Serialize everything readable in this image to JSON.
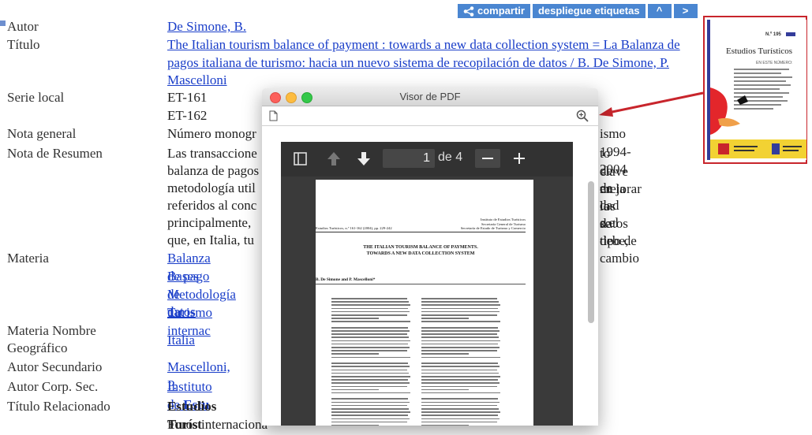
{
  "toolbar": {
    "share": "compartir",
    "tags": "despliegue etiquetas",
    "up": "^",
    "next": ">"
  },
  "record": [
    {
      "label": "Autor",
      "value": "De Simone, B.",
      "link": true
    },
    {
      "label": "Título",
      "value": "The Italian tourism balance of payment : towards a new data collection system = La Balanza de pagos italiana de turismo: hacia un nuevo sistema de recopilación de datos / B. De Simone, P. Mascelloni",
      "link": true
    },
    {
      "label": "Serie local",
      "values": [
        "ET-161",
        "ET-162"
      ]
    },
    {
      "label": "Nota general",
      "value_left": "Número monogr",
      "value_right": "ismo 1994-2004"
    },
    {
      "label": "Nota de Resumen",
      "lines_left": [
        "Las transaccione",
        "balanza de pagos",
        "metodología util",
        "referidos al conc",
        "principalmente,",
        "que, en Italia, tu"
      ],
      "lines_right": [
        "to clave en la",
        "de mejorar la",
        "de los datos",
        "dad se debe,",
        "e el tipo de cambio",
        ""
      ]
    },
    {
      "label": "Materia",
      "values": [
        "Balanza de pago",
        "Bases de datos",
        "Metodología tur",
        "Turismo internac"
      ],
      "link": true
    },
    {
      "label_lines": [
        "Materia Nombre",
        "Geográfico"
      ],
      "value": "Italia",
      "link": true
    },
    {
      "label": "Autor Secundario",
      "value": "Mascelloni, P.",
      "link": true
    },
    {
      "label": "Autor Corp. Sec.",
      "value_plain": "Instituto de ",
      "value_bold": "Estu",
      "link": true
    },
    {
      "label": "Título Relacionado",
      "value": "Estudios Turíst",
      "bold": true
    },
    {
      "label": "",
      "value": "Foros internaciona"
    }
  ],
  "cover": {
    "number": "N.º 195",
    "title": "Estudios Turísticos",
    "subtitle": "EN ESTE NÚMERO:"
  },
  "pdf": {
    "window_title": "Visor de PDF",
    "page_current": "1",
    "page_total_label": "de 4",
    "header_right": [
      "Instituto de Estudios Turísticos",
      "Secretaría General de Turismo",
      "Secretaría de Estado de Turismo y Comercio"
    ],
    "header_left": "Estudios Turísticos, n.º 161-162 (2004), pp. 229-242",
    "title_lines": [
      "THE ITALIAN TOURISM BALANCE OF PAYMENTS.",
      "TOWARDS A NEW DATA COLLECTION SYSTEM"
    ],
    "authors": "B. De Simone and P. Mascelloni*"
  }
}
